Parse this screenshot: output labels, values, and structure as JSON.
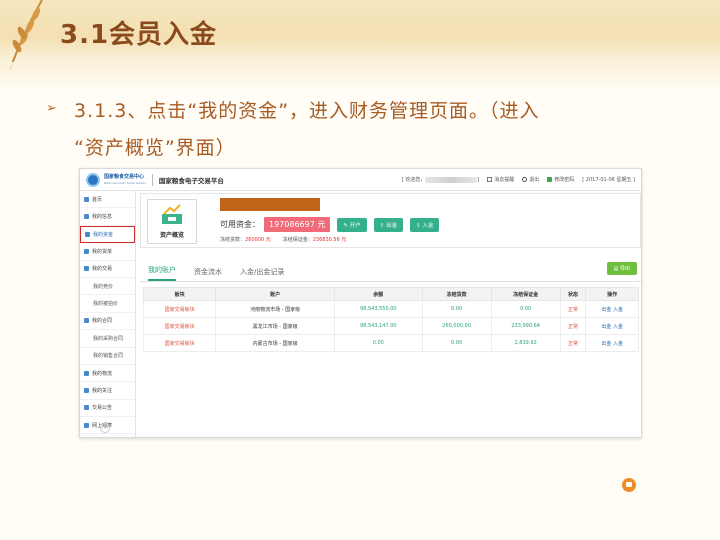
{
  "slide": {
    "title": "3.1会员入金",
    "bullet": "➢",
    "step_line1": "3.1.3、点击“我的资金”，进入财务管理页面。（进入",
    "step_line2": "“资产概览”界面）"
  },
  "app": {
    "logo_cn": "国家粮食交易中心",
    "logo_en": "National Grain Trade Center",
    "platform": "国家粮食电子交易平台",
    "welcome": "[ 欢迎您，",
    "welcome_end": "]",
    "messages": "消息提醒",
    "logout": "退出",
    "change_pwd": "修改密码",
    "date": "[ 2017-01-06 星期五 ]"
  },
  "sidebar": {
    "items": [
      {
        "label": "首页",
        "icon": "home-icon",
        "sub": false
      },
      {
        "label": "我的信息",
        "icon": "user-icon",
        "sub": false
      },
      {
        "label": "我的资金",
        "icon": "wallet-icon",
        "sub": false,
        "active": true
      },
      {
        "label": "我的货单",
        "icon": "goods-icon",
        "sub": false
      },
      {
        "label": "我的交易",
        "icon": "trade-icon",
        "sub": false
      },
      {
        "label": "我的竞价",
        "icon": "",
        "sub": true
      },
      {
        "label": "我的被拍价",
        "icon": "",
        "sub": true
      },
      {
        "label": "我的合同",
        "icon": "contract-icon",
        "sub": false
      },
      {
        "label": "我的采购合同",
        "icon": "",
        "sub": true
      },
      {
        "label": "我的销售合同",
        "icon": "",
        "sub": true
      },
      {
        "label": "我的物流",
        "icon": "truck-icon",
        "sub": false
      },
      {
        "label": "我的关注",
        "icon": "heart-icon",
        "sub": false
      },
      {
        "label": "交易公告",
        "icon": "notice-icon",
        "sub": false
      },
      {
        "label": "网上观摩",
        "icon": "eye-icon",
        "sub": false
      }
    ],
    "collapse": "«"
  },
  "overview": {
    "label": "资产概览",
    "available_label": "可用资金：",
    "available_value": "197086697 元",
    "buttons": [
      "开户",
      "出金",
      "入金"
    ],
    "frozen_goods_label": "冻结货款：",
    "frozen_goods_value": "260000 元",
    "frozen_margin_label": "冻结保证金：",
    "frozen_margin_value": "236830.56 元"
  },
  "tabs": [
    "我的账户",
    "资金流水",
    "入金/出金记录"
  ],
  "export_label": "导出",
  "table": {
    "headers": [
      "板块",
      "账户",
      "余额",
      "冻结货款",
      "冻结保证金",
      "状态",
      "操作"
    ],
    "rows": [
      [
        "国家交易板块",
        "河南物流市场 - 国家级",
        "98,543,550.00",
        "0.00",
        "0.00",
        "正常",
        "出金 入金"
      ],
      [
        "国家交易板块",
        "黑龙江市场 - 国家级",
        "98,543,147.00",
        "260,000.00",
        "233,990.64",
        "正常",
        "出金 入金"
      ],
      [
        "国家交易板块",
        "内蒙古市场 - 国家级",
        "0.00",
        "0.00",
        "2,839.92",
        "正常",
        "出金 入金"
      ]
    ]
  },
  "colors": {
    "accent_green": "#35b08c",
    "highlight_red": "#d02c2c",
    "title_brown": "#8a4a1c"
  }
}
